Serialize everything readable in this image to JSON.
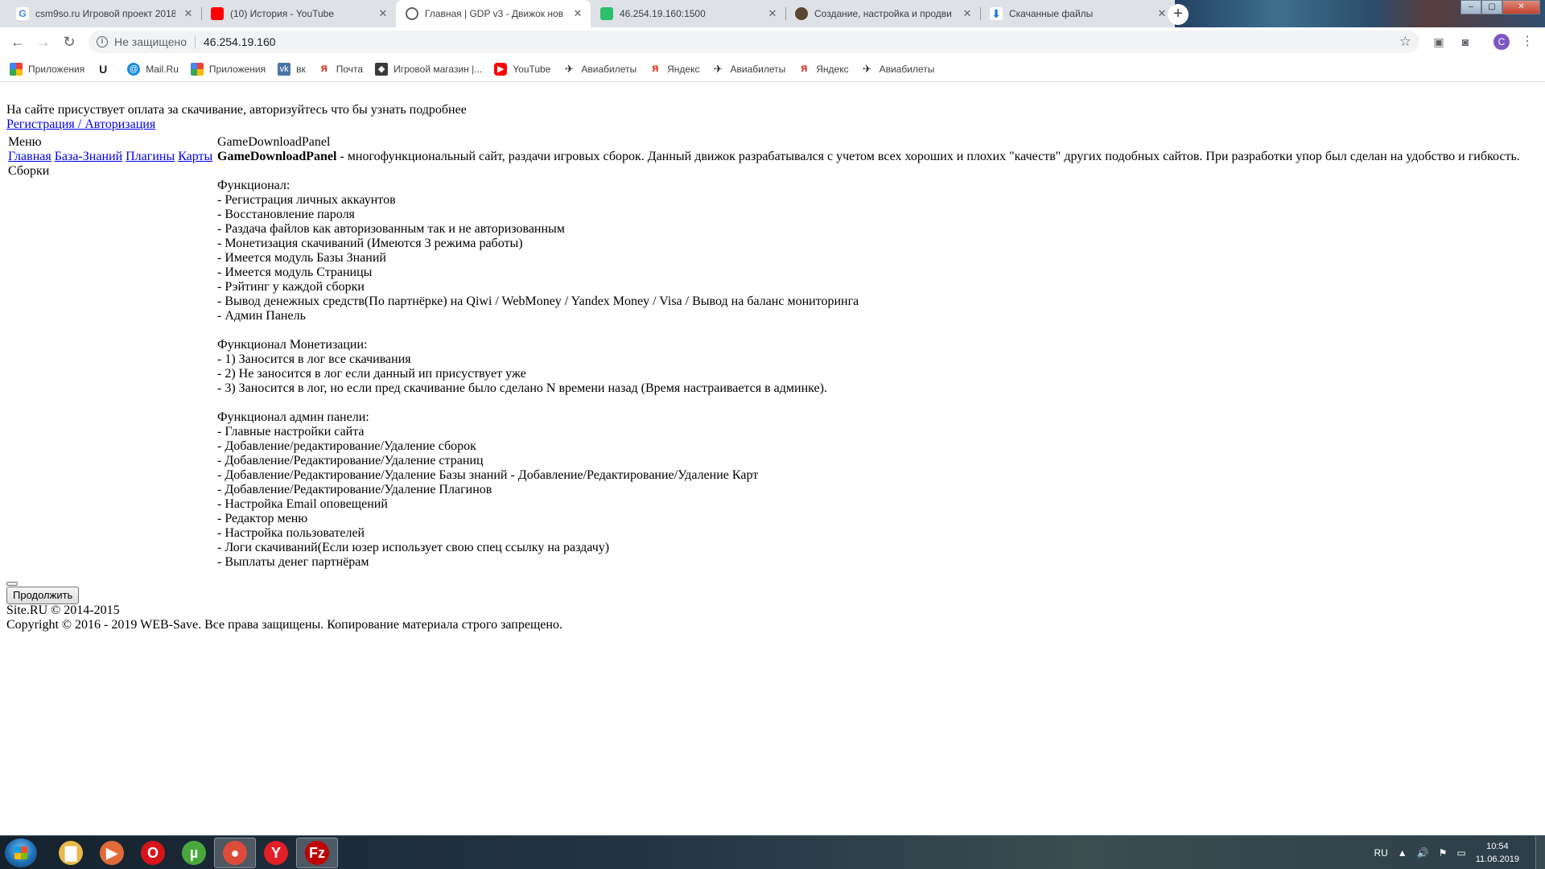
{
  "browser": {
    "tabs": [
      {
        "title": "csm9so.ru Игровой проект 2018",
        "icon": "google-icon",
        "active": false
      },
      {
        "title": "(10) История - YouTube",
        "icon": "youtube-icon",
        "active": false
      },
      {
        "title": "Главная | GDP v3 - Движок нов",
        "icon": "globe-icon",
        "active": true
      },
      {
        "title": "46.254.19.160:1500",
        "icon": "ispmanager-icon",
        "active": false
      },
      {
        "title": "Создание, настройка и продви",
        "icon": "user-icon",
        "active": false
      },
      {
        "title": "Скачанные файлы",
        "icon": "download-icon",
        "active": false
      }
    ],
    "new_tab": "+",
    "omnibox": {
      "security": "Не защищено",
      "url": "46.254.19.160"
    },
    "avatar_letter": "C",
    "bookmarks": [
      {
        "label": "Приложения",
        "icon": "apps-grid-icon"
      },
      {
        "label": "",
        "icon": "utorrent-icon"
      },
      {
        "label": "Mail.Ru",
        "icon": "mailru-icon"
      },
      {
        "label": "Приложения",
        "icon": "apps-grid-icon"
      },
      {
        "label": "вк",
        "icon": "vk-icon"
      },
      {
        "label": "Почта",
        "icon": "yandex-icon"
      },
      {
        "label": "Игровой магазин |...",
        "icon": "game-store-icon"
      },
      {
        "label": "YouTube",
        "icon": "youtube-icon"
      },
      {
        "label": "Авиабилеты",
        "icon": "plane-icon"
      },
      {
        "label": "Яндекс",
        "icon": "yandex-icon"
      },
      {
        "label": "Авиабилеты",
        "icon": "plane-icon"
      },
      {
        "label": "Яндекс",
        "icon": "yandex-icon"
      },
      {
        "label": "Авиабилеты",
        "icon": "plane-icon"
      }
    ]
  },
  "page": {
    "notice": "На сайте присуствует оплата за скачивание, авторизуйтесь что бы узнать подробнее",
    "auth_link": "Регистрация / Авторизация",
    "menu": {
      "title": "Меню",
      "links": [
        "Главная",
        "База-Знаний",
        "Плагины",
        "Карты"
      ],
      "extra": "Сборки"
    },
    "content": {
      "site_title": "GameDownloadPanel",
      "intro_bold": "GameDownloadPanel",
      "intro_text": " - многофункциональный сайт, раздачи игровых сборок. Данный движок разрабатывался с учетом всех хороших и плохих \"качеств\" других подобных сайтов. При разработки упор был сделан на удобство и гибкость.",
      "features_title": "Функционал:",
      "features": [
        "- Регистрация личных аккаунтов",
        "- Восстановление пароля",
        "- Раздача файлов как авторизованным так и не авторизованным",
        "- Монетизация скачиваний (Имеются 3 режима работы)",
        "- Имеется модуль Базы Знаний",
        "- Имеется модуль Страницы",
        "- Рэйтинг у каждой сборки",
        "- Вывод денежных средств(По партнёрке) на Qiwi / WebMoney / Yandex Money / Visa / Вывод на баланс мониторинга",
        "- Админ Панель"
      ],
      "monetization_title": "Функционал Монетизации:",
      "monetization": [
        "- 1) Заносится в лог все скачивания",
        "- 2) Не заносится в лог если данный ип присуствует уже",
        "- 3) Заносится в лог, но если пред скачивание было сделано N времени назад (Время настраивается в админке)."
      ],
      "admin_title": "Функционал админ панели:",
      "admin": [
        "- Главные настройки сайта",
        "- Добавление/редактирование/Удаление сборок",
        "- Добавление/Редактирование/Удаление страниц",
        "- Добавление/Редактирование/Удаление Базы знаний - Добавление/Редактирование/Удаление Карт",
        "- Добавление/Редактирование/Удаление Плагинов",
        "- Настройка Email оповещений",
        "- Редактор меню",
        "- Настройка пользователей",
        "- Логи скачиваний(Если юзер использует свою спец ссылку на раздачу)",
        "- Выплаты денег партнёрам"
      ]
    },
    "continue_button": "Продолжить",
    "footer_line1": "Site.RU © 2014-2015",
    "footer_line2": "Copyright © 2016 - 2019 WEB-Save. Все права защищены. Копирование материала строго запрещено."
  },
  "taskbar": {
    "apps": [
      {
        "name": "explorer",
        "icon": "folder-icon",
        "glyph": "▇",
        "color": "#e8b84a",
        "active": false
      },
      {
        "name": "media-player",
        "icon": "media-player-icon",
        "glyph": "▶",
        "color": "#e06a3a",
        "active": false
      },
      {
        "name": "opera",
        "icon": "opera-icon",
        "glyph": "O",
        "color": "#d7141a",
        "active": false
      },
      {
        "name": "utorrent",
        "icon": "utorrent-icon",
        "glyph": "µ",
        "color": "#4aa73c",
        "active": false
      },
      {
        "name": "chrome",
        "icon": "chrome-icon",
        "glyph": "●",
        "color": "#dd4b39",
        "active": true
      },
      {
        "name": "yandex-browser",
        "icon": "yandex-browser-icon",
        "glyph": "Y",
        "color": "#e01f26",
        "active": false
      },
      {
        "name": "filezilla",
        "icon": "filezilla-icon",
        "glyph": "Fz",
        "color": "#bf0000",
        "active": true
      }
    ],
    "language": "RU",
    "time": "10:54",
    "date": "11.06.2019"
  }
}
